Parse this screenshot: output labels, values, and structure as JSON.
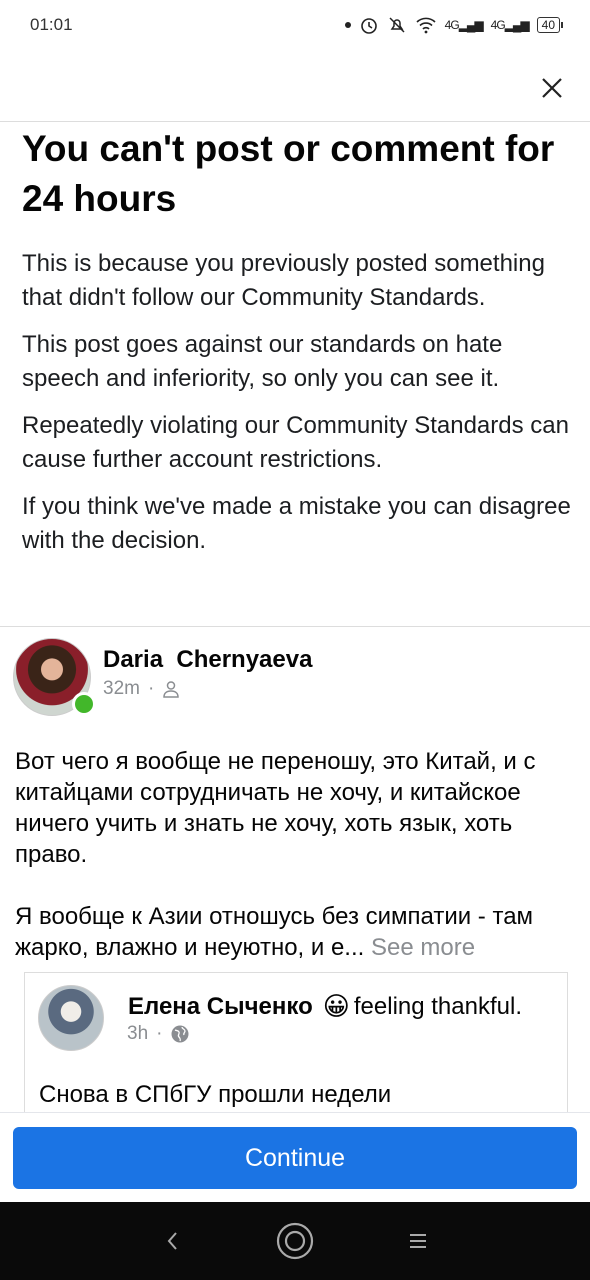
{
  "status_bar": {
    "time": "01:01",
    "network_1": "4G",
    "network_2": "4G",
    "battery": "40"
  },
  "notice": {
    "title": "You can't post or comment for 24 hours",
    "para1": "This is because you previously posted something that didn't follow our Community Standards.",
    "para2": "This post goes against our standards on hate speech and inferiority, so only you can see it.",
    "para3": "Repeatedly violating our Community Standards can cause further account restrictions.",
    "para4": "If you think we've made a mistake you can disagree with the decision."
  },
  "post": {
    "author": "Daria  Chernyaeva",
    "time": "32m",
    "separator": "·",
    "audience_icon": "friends-icon",
    "text_para1": "Вот чего я вообще не переношу, это Китай, и с китайцами сотрудничать не хочу, и китайское ничего учить и знать не хочу, хоть язык, хоть право.",
    "text_para2": "Я вообще к Азии отношусь без симпатии - там жарко, влажно и неуютно, и е...",
    "see_more": "See more"
  },
  "shared_post": {
    "author": "Елена Сыченко",
    "emoji": "😀",
    "feeling": "feeling thankful.",
    "time": "3h",
    "separator": "·",
    "audience_icon": "globe-icon",
    "text": "Снова в СПбГУ прошли недели"
  },
  "actions": {
    "continue_label": "Continue"
  },
  "colors": {
    "accent": "#1b74e4",
    "online": "#42b72a"
  }
}
